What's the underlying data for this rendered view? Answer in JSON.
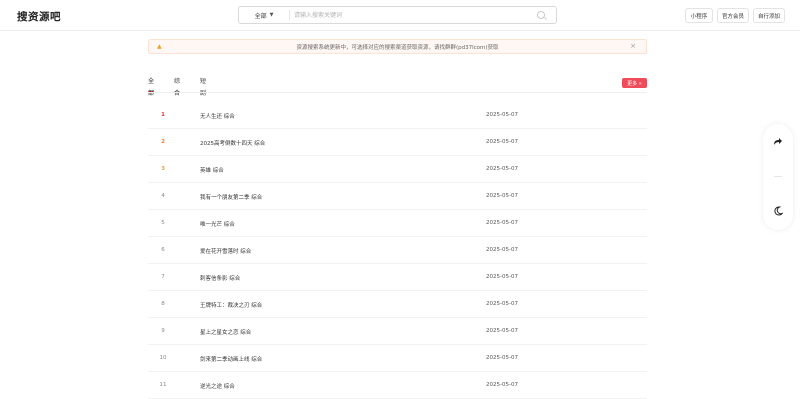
{
  "header": {
    "logo": "搜资源吧",
    "search": {
      "category": "全部",
      "placeholder": "请输入搜索关键词"
    },
    "buttons": [
      "小程序",
      "官方会员",
      "自行添加"
    ]
  },
  "notice": {
    "text": "资源搜索系统更新中，可选择对应的搜索渠道获取资源，请找群群(pd37lcom)获取"
  },
  "tabs": [
    "全部",
    "综合",
    "短剧"
  ],
  "more_label": "更多 »",
  "list": [
    {
      "rank": "1",
      "title": "无人生还 综合",
      "date": "2025-05-07"
    },
    {
      "rank": "2",
      "title": "2025高考倒数十四天 综合",
      "date": "2025-05-07"
    },
    {
      "rank": "3",
      "title": "英雄 综合",
      "date": "2025-05-07"
    },
    {
      "rank": "4",
      "title": "我有一个朋友第二季 综合",
      "date": "2025-05-07"
    },
    {
      "rank": "5",
      "title": "唯一光芒 综合",
      "date": "2025-05-07"
    },
    {
      "rank": "6",
      "title": "爱在花开雪落时 综合",
      "date": "2025-05-07"
    },
    {
      "rank": "7",
      "title": "刺客信条影 综合",
      "date": "2025-05-07"
    },
    {
      "rank": "8",
      "title": "王牌特工：裁决之刃 综合",
      "date": "2025-05-07"
    },
    {
      "rank": "9",
      "title": "星上之星女之恋 综合",
      "date": "2025-05-07"
    },
    {
      "rank": "10",
      "title": "剑来第二季动画上线 综合",
      "date": "2025-05-07"
    },
    {
      "rank": "11",
      "title": "逆光之途 综合",
      "date": "2025-05-07"
    }
  ],
  "side_tools": {
    "share_icon": "share-icon",
    "theme_icon": "moon-icon"
  },
  "colors": {
    "accent": "#f04b5a",
    "rank1": "#e53935",
    "rank2": "#ef7b2b",
    "rank3": "#f0a535",
    "notice_bg": "#fff7f3"
  }
}
